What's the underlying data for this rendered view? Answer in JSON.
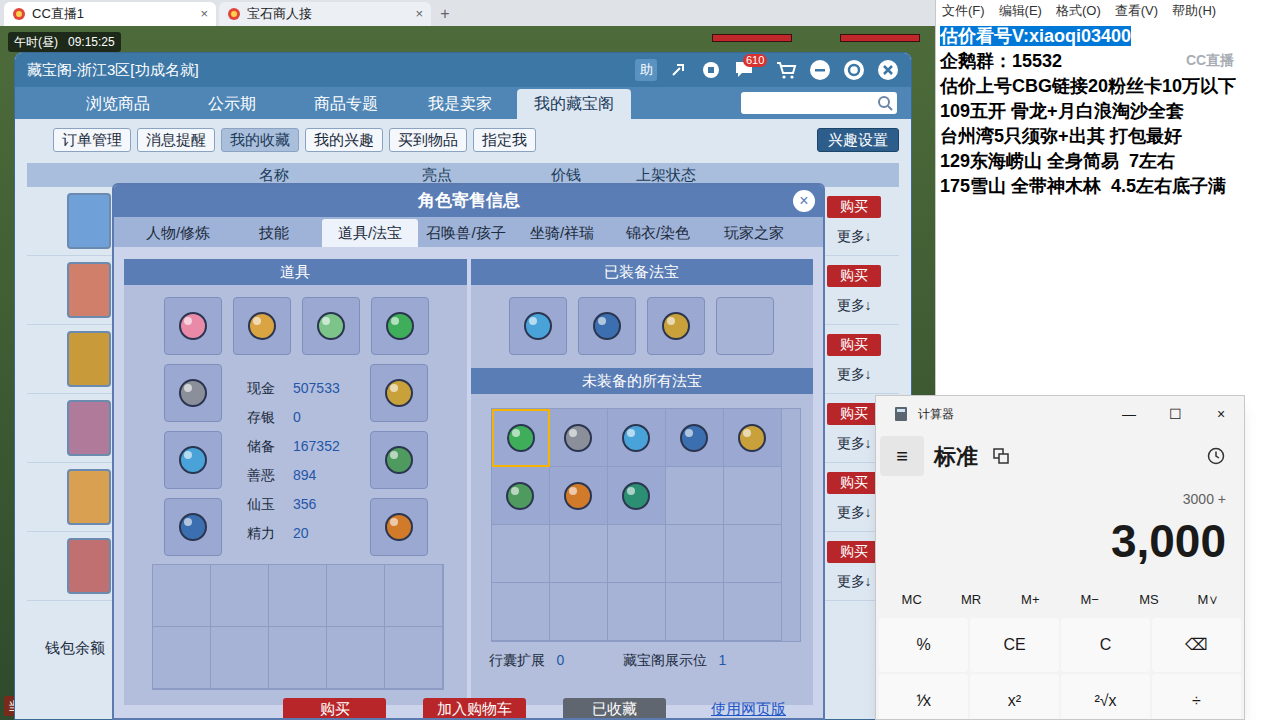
{
  "browser": {
    "tabs": [
      {
        "label": "CC直播1",
        "close": "×",
        "selected": true
      },
      {
        "label": "宝石商人接",
        "close": "×",
        "selected": false
      }
    ],
    "new_tab": "+"
  },
  "game_hud": {
    "period": "午时(昼)",
    "time": "09:15:25",
    "bottom_label": "当前"
  },
  "cbg": {
    "title": "藏宝阁-浙江3区[功成名就]",
    "help": "助",
    "chat_badge": "610",
    "tabs": [
      {
        "label": "浏览商品",
        "selected": false
      },
      {
        "label": "公示期",
        "selected": false
      },
      {
        "label": "商品专题",
        "selected": false
      },
      {
        "label": "我是卖家",
        "selected": false
      },
      {
        "label": "我的藏宝阁",
        "selected": true
      }
    ],
    "subtabs": [
      {
        "label": "订单管理",
        "selected": false
      },
      {
        "label": "消息提醒",
        "selected": false
      },
      {
        "label": "我的收藏",
        "selected": true
      },
      {
        "label": "我的兴趣",
        "selected": false
      },
      {
        "label": "买到物品",
        "selected": false
      },
      {
        "label": "指定我",
        "selected": false
      }
    ],
    "interest_settings": "兴趣设置",
    "columns": [
      "名称",
      "亮点",
      "价钱",
      "上架状态"
    ],
    "rows": [
      {
        "buy": "购买",
        "more": "更多↓"
      },
      {
        "buy": "购买",
        "more": "更多↓"
      },
      {
        "buy": "购买",
        "more": "更多↓"
      },
      {
        "buy": "购买",
        "more": "更多↓"
      },
      {
        "buy": "购买",
        "more": "更多↓"
      },
      {
        "buy": "购买",
        "more": "更多↓"
      }
    ],
    "wallet": "钱包余额"
  },
  "dialog": {
    "title": "角色寄售信息",
    "close": "×",
    "tabs": [
      {
        "label": "人物/修炼",
        "selected": false
      },
      {
        "label": "技能",
        "selected": false
      },
      {
        "label": "道具/法宝",
        "selected": true
      },
      {
        "label": "召唤兽/孩子",
        "selected": false
      },
      {
        "label": "坐骑/祥瑞",
        "selected": false
      },
      {
        "label": "锦衣/染色",
        "selected": false
      },
      {
        "label": "玩家之家",
        "selected": false
      }
    ],
    "items_header": "道具",
    "equipment": [
      {
        "filled": true
      },
      {
        "filled": true
      },
      {
        "filled": true
      },
      {
        "filled": true
      },
      {
        "filled": true
      },
      {
        "filled": true
      },
      {
        "filled": true
      },
      {
        "filled": true
      },
      {
        "filled": true
      },
      {
        "filled": true
      }
    ],
    "stats": [
      {
        "label": "现金",
        "value": "507533"
      },
      {
        "label": "存银",
        "value": "0"
      },
      {
        "label": "储备",
        "value": "167352"
      },
      {
        "label": "善恶",
        "value": "894"
      },
      {
        "label": "仙玉",
        "value": "356"
      },
      {
        "label": "精力",
        "value": "20"
      }
    ],
    "inventory": [
      {
        "filled": false
      },
      {
        "filled": false
      },
      {
        "filled": false
      },
      {
        "filled": false
      },
      {
        "filled": false
      },
      {
        "filled": false
      },
      {
        "filled": false
      },
      {
        "filled": false
      },
      {
        "filled": false
      },
      {
        "filled": false
      }
    ],
    "equipped_header": "已装备法宝",
    "equipped": [
      {
        "filled": true
      },
      {
        "filled": true
      },
      {
        "filled": true
      },
      {
        "filled": false
      }
    ],
    "unequipped_header": "未装备的所有法宝",
    "unequipped": [
      {
        "filled": true,
        "selected": true
      },
      {
        "filled": true,
        "selected": false
      },
      {
        "filled": true,
        "selected": false
      },
      {
        "filled": true,
        "selected": false
      },
      {
        "filled": true,
        "selected": false
      },
      {
        "filled": true,
        "selected": false
      },
      {
        "filled": true,
        "selected": false
      },
      {
        "filled": true,
        "selected": false
      },
      {
        "filled": false,
        "selected": false
      },
      {
        "filled": false,
        "selected": false
      },
      {
        "filled": false,
        "selected": false
      },
      {
        "filled": false,
        "selected": false
      },
      {
        "filled": false,
        "selected": false
      },
      {
        "filled": false,
        "selected": false
      },
      {
        "filled": false,
        "selected": false
      },
      {
        "filled": false,
        "selected": false
      },
      {
        "filled": false,
        "selected": false
      },
      {
        "filled": false,
        "selected": false
      },
      {
        "filled": false,
        "selected": false
      },
      {
        "filled": false,
        "selected": false
      }
    ],
    "footer": [
      {
        "label": "行囊扩展",
        "value": "0"
      },
      {
        "label": "藏宝阁展示位",
        "value": "1"
      }
    ],
    "buttons": [
      {
        "label": "购买",
        "kind": "button",
        "disabled": false
      },
      {
        "label": "加入购物车",
        "kind": "button",
        "disabled": false
      },
      {
        "label": "已收藏",
        "kind": "button",
        "disabled": true
      },
      {
        "label": "使用网页版",
        "kind": "link",
        "disabled": false
      }
    ]
  },
  "notepad": {
    "menu": [
      "文件(F)",
      "编辑(E)",
      "格式(O)",
      "查看(V)",
      "帮助(H)"
    ],
    "lines": [
      {
        "text": "估价看号V:xiaoqi03400",
        "selected": true
      },
      {
        "text": "企鹅群：15532",
        "selected": false
      },
      {
        "text": "估价上号CBG链接20粉丝卡10万以下",
        "selected": false
      },
      {
        "text": "109五开 骨龙+月白浪淘沙全套",
        "selected": false
      },
      {
        "text": "台州湾5只须弥+出其 打包最好",
        "selected": false
      },
      {
        "text": "129东海崂山 全身简易  7左右",
        "selected": false
      },
      {
        "text": "175雪山 全带神木林  4.5左右底子满",
        "selected": false
      }
    ]
  },
  "watermark": "CC直播",
  "calculator": {
    "title": "计算器",
    "controls": [
      "—",
      "☐",
      "×"
    ],
    "menu_icon": "≡",
    "mode": "标准",
    "expression": "3000 +",
    "display": "3,000",
    "memory": [
      "MC",
      "MR",
      "M+",
      "M−",
      "MS",
      "M∨"
    ],
    "keys": [
      "%",
      "CE",
      "C",
      "⌫",
      "⅟x",
      "x²",
      "²√x",
      "÷"
    ]
  }
}
